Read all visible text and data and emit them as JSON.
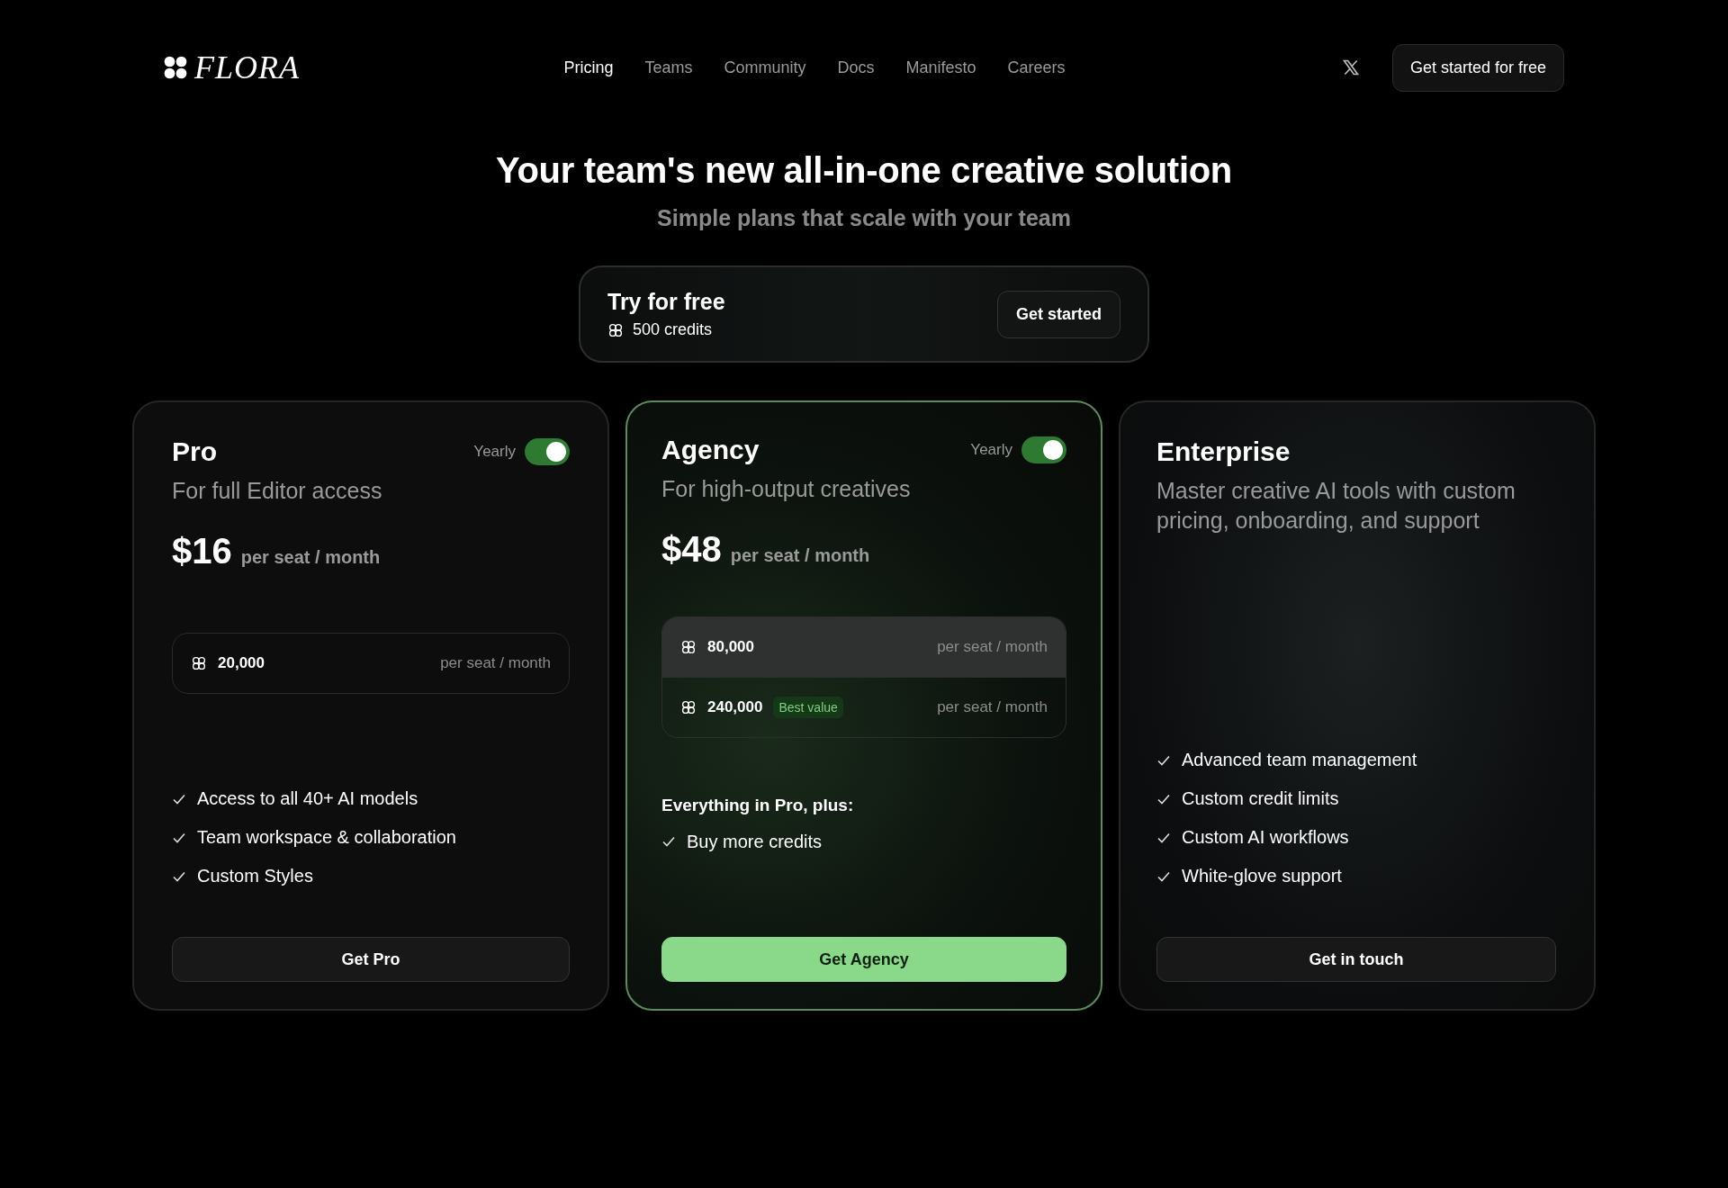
{
  "header": {
    "logo": "FLORA",
    "nav": [
      {
        "label": "Pricing",
        "selected": true
      },
      {
        "label": "Teams",
        "selected": false
      },
      {
        "label": "Community",
        "selected": false
      },
      {
        "label": "Docs",
        "selected": false
      },
      {
        "label": "Manifesto",
        "selected": false
      },
      {
        "label": "Careers",
        "selected": false
      }
    ],
    "cta": "Get started for free"
  },
  "hero": {
    "title": "Your team's new all-in-one creative solution",
    "subtitle": "Simple plans that scale with your team"
  },
  "free_plan": {
    "title": "Try for free",
    "credits": "500 credits",
    "button": "Get started"
  },
  "plans": [
    {
      "name": "Pro",
      "highlighted": false,
      "toggle": {
        "label": "Yearly",
        "on": true
      },
      "tagline": "For full Editor access",
      "price": "$16",
      "unit": "per seat / month",
      "credit_options": [
        {
          "amount": "20,000",
          "unit": "per seat / month",
          "selected": false
        }
      ],
      "features": [
        "Access to all 40+ AI models",
        "Team workspace & collaboration",
        "Custom Styles"
      ],
      "button": "Get Pro"
    },
    {
      "name": "Agency",
      "highlighted": true,
      "toggle": {
        "label": "Yearly",
        "on": true
      },
      "tagline": "For high-output creatives",
      "price": "$48",
      "unit": "per seat / month",
      "credit_options": [
        {
          "amount": "80,000",
          "unit": "per seat / month",
          "selected": true
        },
        {
          "amount": "240,000",
          "badge": "Best value",
          "unit": "per seat / month",
          "selected": false
        }
      ],
      "features_heading": "Everything in Pro, plus:",
      "features": [
        "Buy more credits"
      ],
      "button": "Get Agency"
    },
    {
      "name": "Enterprise",
      "highlighted": false,
      "tagline": "Master creative AI tools with custom pricing, onboarding, and support",
      "features": [
        "Advanced team management",
        "Custom credit limits",
        "Custom AI workflows",
        "White-glove support"
      ],
      "button": "Get in touch"
    }
  ]
}
